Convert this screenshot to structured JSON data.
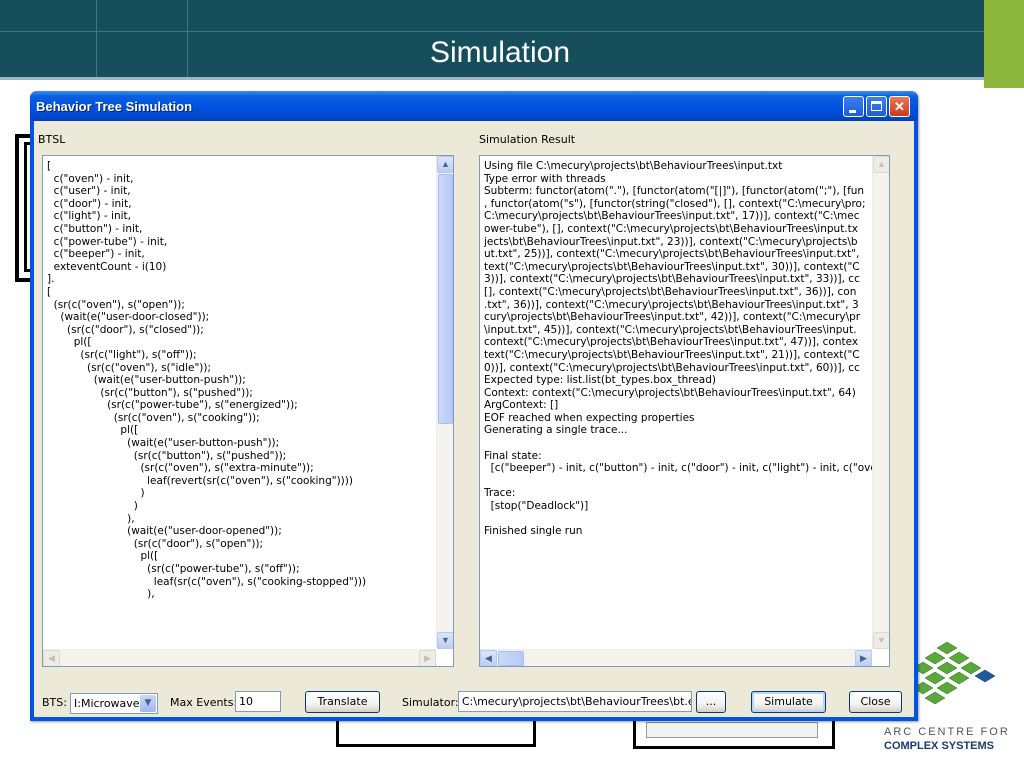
{
  "slide": {
    "title": "Simulation",
    "logo_line1": "ARC CENTRE FOR",
    "logo_line2": "COMPLEX SYSTEMS",
    "colors": {
      "header": "#164e5c",
      "accent": "#8cb63c"
    }
  },
  "window": {
    "title": "Behavior Tree Simulation",
    "controls": {
      "minimize": "minimize-icon",
      "maximize": "maximize-icon",
      "close": "close-icon"
    }
  },
  "btsl": {
    "label": "BTSL",
    "lines": [
      "[",
      "  c(\"oven\") - init,",
      "  c(\"user\") - init,",
      "  c(\"door\") - init,",
      "  c(\"light\") - init,",
      "  c(\"button\") - init,",
      "  c(\"power-tube\") - init,",
      "  c(\"beeper\") - init,",
      "  exteventCount - i(10)",
      "].",
      "[",
      "  (sr(c(\"oven\"), s(\"open\"));",
      "    (wait(e(\"user-door-closed\"));",
      "      (sr(c(\"door\"), s(\"closed\"));",
      "        pl([",
      "          (sr(c(\"light\"), s(\"off\"));",
      "            (sr(c(\"oven\"), s(\"idle\"));",
      "              (wait(e(\"user-button-push\"));",
      "                (sr(c(\"button\"), s(\"pushed\"));",
      "                  (sr(c(\"power-tube\"), s(\"energized\"));",
      "                    (sr(c(\"oven\"), s(\"cooking\"));",
      "                      pl([",
      "                        (wait(e(\"user-button-push\"));",
      "                          (sr(c(\"button\"), s(\"pushed\"));",
      "                            (sr(c(\"oven\"), s(\"extra-minute\"));",
      "                              leaf(revert(sr(c(\"oven\"), s(\"cooking\"))))",
      "                            )",
      "                          )",
      "                        ),",
      "                        (wait(e(\"user-door-opened\"));",
      "                          (sr(c(\"door\"), s(\"open\"));",
      "                            pl([",
      "                              (sr(c(\"power-tube\"), s(\"off\"));",
      "                                leaf(sr(c(\"oven\"), s(\"cooking-stopped\")))",
      "                              ),"
    ]
  },
  "result": {
    "label": "Simulation Result",
    "lines": [
      "Using file C:\\mecury\\projects\\bt\\BehaviourTrees\\input.txt",
      "Type error with threads",
      "Subterm: functor(atom(\".\"), [functor(atom(\"[|]\"), [functor(atom(\";\"), [fun",
      ", functor(atom(\"s\"), [functor(string(\"closed\"), [], context(\"C:\\mecury\\pro;",
      "C:\\mecury\\projects\\bt\\BehaviourTrees\\input.txt\", 17))], context(\"C:\\mec",
      "ower-tube\"), [], context(\"C:\\mecury\\projects\\bt\\BehaviourTrees\\input.tx",
      "jects\\bt\\BehaviourTrees\\input.txt\", 23))], context(\"C:\\mecury\\projects\\b",
      "ut.txt\", 25))], context(\"C:\\mecury\\projects\\bt\\BehaviourTrees\\input.txt\",",
      "text(\"C:\\mecury\\projects\\bt\\BehaviourTrees\\input.txt\", 30))], context(\"C",
      "3))], context(\"C:\\mecury\\projects\\bt\\BehaviourTrees\\input.txt\", 33))], cc",
      "[], context(\"C:\\mecury\\projects\\bt\\BehaviourTrees\\input.txt\", 36))], con",
      ".txt\", 36))], context(\"C:\\mecury\\projects\\bt\\BehaviourTrees\\input.txt\", 3",
      "cury\\projects\\bt\\BehaviourTrees\\input.txt\", 42))], context(\"C:\\mecury\\pr",
      "\\input.txt\", 45))], context(\"C:\\mecury\\projects\\bt\\BehaviourTrees\\input.",
      "context(\"C:\\mecury\\projects\\bt\\BehaviourTrees\\input.txt\", 47))], contex",
      "text(\"C:\\mecury\\projects\\bt\\BehaviourTrees\\input.txt\", 21))], context(\"C",
      "0))], context(\"C:\\mecury\\projects\\bt\\BehaviourTrees\\input.txt\", 60))], cc",
      "Expected type: list.list(bt_types.box_thread)",
      "Context: context(\"C:\\mecury\\projects\\bt\\BehaviourTrees\\input.txt\", 64)",
      "ArgContext: []",
      "EOF reached when expecting properties",
      "Generating a single trace...",
      "",
      "Final state:",
      "  [c(\"beeper\") - init, c(\"button\") - init, c(\"door\") - init, c(\"light\") - init, c(\"ove",
      "",
      "Trace:",
      "  [stop(\"Deadlock\")]",
      "",
      "Finished single run"
    ]
  },
  "controls": {
    "bts_label": "BTS:",
    "bts_value": "I:Microwave",
    "max_events_label": "Max Events:",
    "max_events_value": "10",
    "translate_label": "Translate",
    "simulator_label": "Simulator:",
    "simulator_value": "C:\\mecury\\projects\\bt\\BehaviourTrees\\bt.ex",
    "browse_label": "...",
    "simulate_label": "Simulate",
    "close_label": "Close"
  }
}
